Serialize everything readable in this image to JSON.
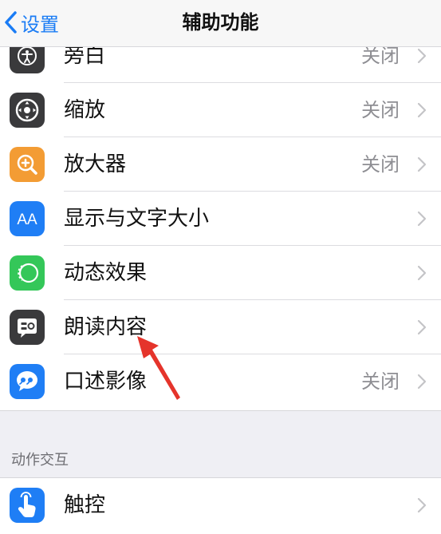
{
  "navbar": {
    "back_label": "设置",
    "title": "辅助功能"
  },
  "rows": [
    {
      "name": "voiceover",
      "label": "旁白",
      "value": "关闭",
      "icon": "accessibility-person-icon",
      "icon_color": "#3a3a3c"
    },
    {
      "name": "zoom",
      "label": "缩放",
      "value": "关闭",
      "icon": "zoom-icon",
      "icon_color": "#3a3a3c"
    },
    {
      "name": "magnifier",
      "label": "放大器",
      "value": "关闭",
      "icon": "magnifier-icon",
      "icon_color": "#f39c34"
    },
    {
      "name": "display-text-size",
      "label": "显示与文字大小",
      "value": "",
      "icon": "text-size-icon",
      "icon_color": "#1f7ef5"
    },
    {
      "name": "motion",
      "label": "动态效果",
      "value": "",
      "icon": "motion-icon",
      "icon_color": "#34c759"
    },
    {
      "name": "spoken-content",
      "label": "朗读内容",
      "value": "",
      "icon": "spoken-content-icon",
      "icon_color": "#3a3a3c"
    },
    {
      "name": "audio-descriptions",
      "label": "口述影像",
      "value": "关闭",
      "icon": "audio-description-icon",
      "icon_color": "#1f7ef5"
    }
  ],
  "section_interaction": {
    "header": "动作交互",
    "rows": [
      {
        "name": "touch",
        "label": "触控",
        "value": "",
        "icon": "touch-hand-icon",
        "icon_color": "#1f7ef5"
      }
    ]
  },
  "colors": {
    "accent": "#1a7cf5",
    "annotation_arrow": "#e5342b"
  }
}
